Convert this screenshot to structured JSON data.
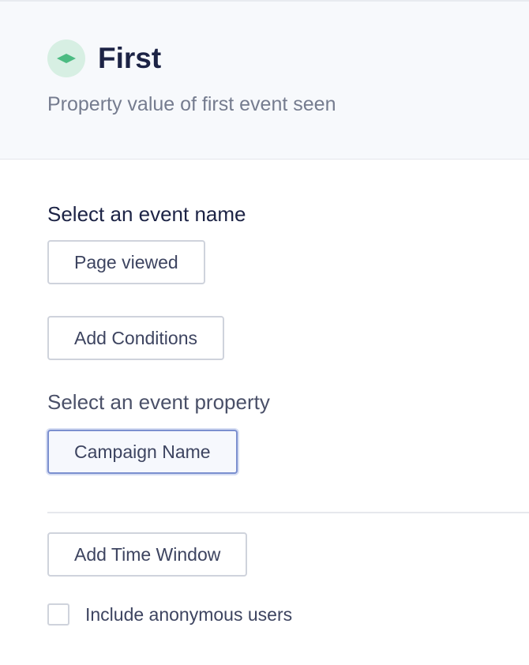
{
  "header": {
    "icon": "first-value-icon",
    "title": "First",
    "subtitle": "Property value of first event seen"
  },
  "event_name": {
    "label": "Select an event name",
    "value": "Page viewed"
  },
  "conditions": {
    "button_label": "Add Conditions"
  },
  "event_property": {
    "label": "Select an event property",
    "value": "Campaign Name"
  },
  "time_window": {
    "button_label": "Add Time Window"
  },
  "anonymous": {
    "label": "Include anonymous users",
    "checked": false
  },
  "colors": {
    "accent_green": "#4cbb82",
    "icon_background": "#d7efe3",
    "selected_border": "#7b8fcf",
    "title_text": "#1c2345"
  }
}
